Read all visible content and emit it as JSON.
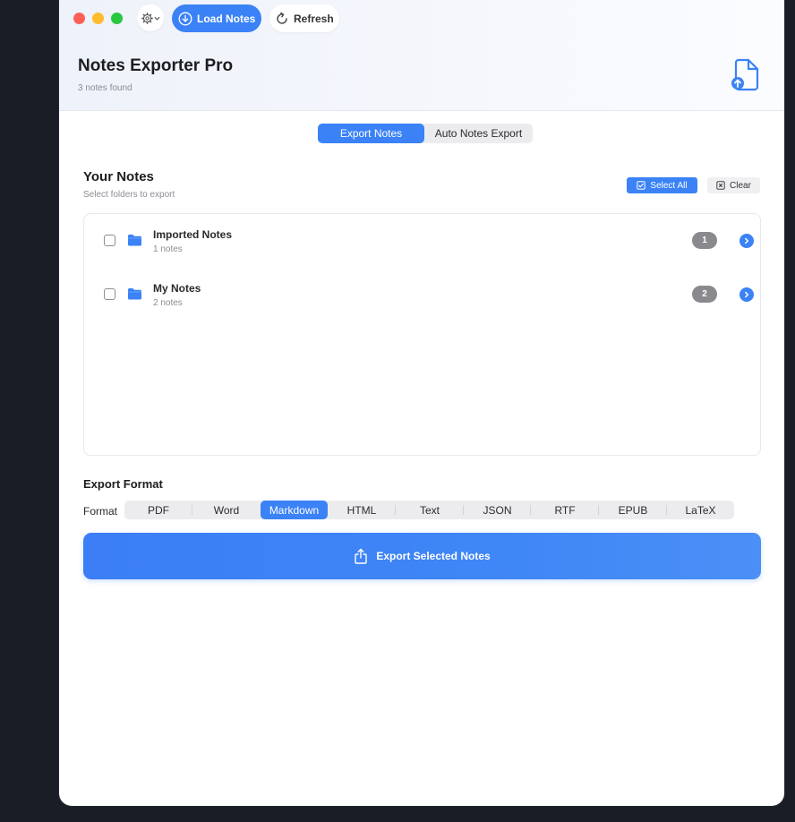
{
  "toolbar": {
    "load_label": "Load Notes",
    "refresh_label": "Refresh"
  },
  "header": {
    "title": "Notes Exporter Pro",
    "subtitle": "3 notes found"
  },
  "tabs": [
    {
      "label": "Export Notes",
      "active": true
    },
    {
      "label": "Auto Notes Export",
      "active": false
    }
  ],
  "notes_section": {
    "title": "Your Notes",
    "subtitle": "Select folders to export",
    "select_all_label": "Select All",
    "clear_label": "Clear",
    "folders": [
      {
        "name": "Imported Notes",
        "count_text": "1 notes",
        "badge": "1",
        "checked": false
      },
      {
        "name": "My Notes",
        "count_text": "2 notes",
        "badge": "2",
        "checked": false
      }
    ]
  },
  "format_section": {
    "title": "Export Format",
    "label": "Format",
    "options": [
      "PDF",
      "Word",
      "Markdown",
      "HTML",
      "Text",
      "JSON",
      "RTF",
      "EPUB",
      "LaTeX"
    ],
    "selected": "Markdown"
  },
  "export_button_label": "Export Selected Notes",
  "colors": {
    "accent": "#3b82f6",
    "badge": "#8a8a8e",
    "close": "#fe5f57",
    "minimize": "#febc2e",
    "zoom": "#28c840"
  },
  "icons": {
    "gear": "gear-icon",
    "load": "download-circle-icon",
    "refresh": "refresh-icon",
    "app": "document-upload-icon",
    "folder": "folder-icon",
    "chevron": "chevron-right-icon",
    "export": "share-icon"
  }
}
